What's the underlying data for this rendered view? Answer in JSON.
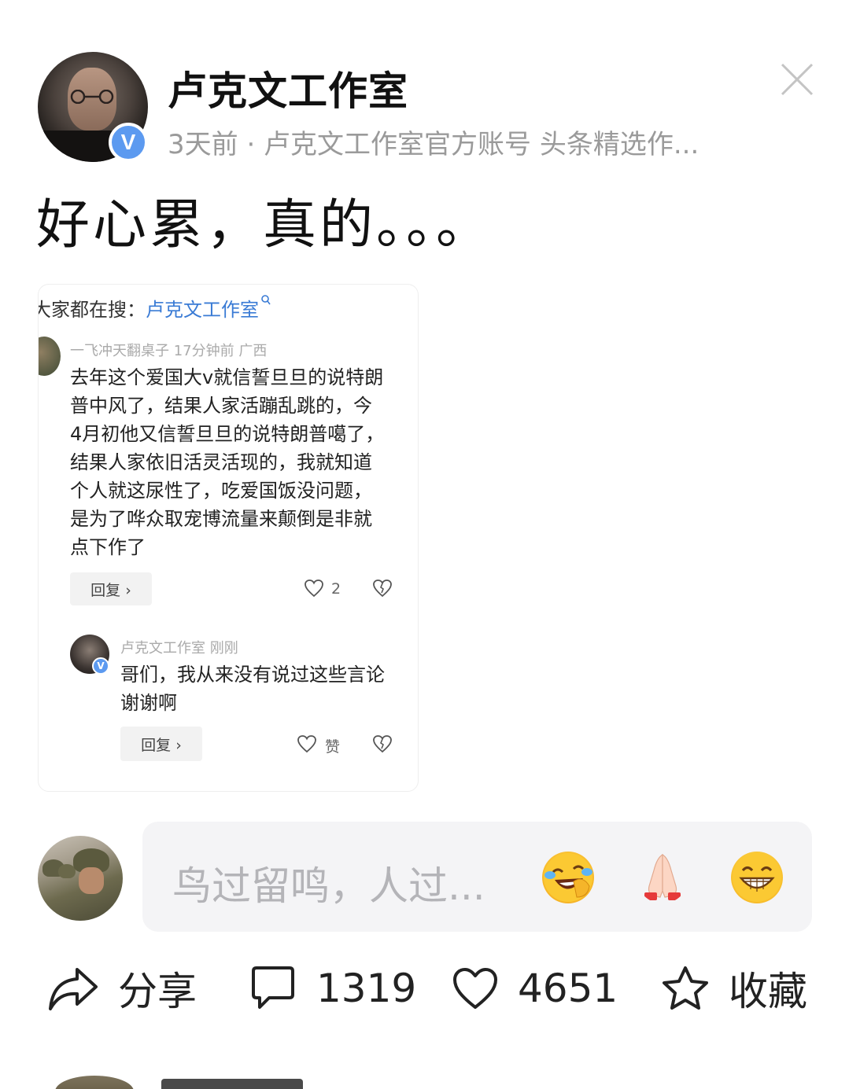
{
  "post": {
    "author": "卢克文工作室",
    "verified_badge": "V",
    "meta": "3天前 · 卢克文工作室官方账号 头条精选作...",
    "title": "好心累，真的。。。"
  },
  "image_comment": {
    "search_prefix": "大家都在搜：",
    "search_keyword": "卢克文工作室",
    "first": {
      "meta": "一飞冲天翻桌子  17分钟前  广西",
      "lines": [
        "去年这个爱国大v就信誓旦旦的说特朗",
        "普中风了，结果人家活蹦乱跳的，今",
        "4月初他又信誓旦旦的说特朗普噶了，",
        "结果人家依旧活灵活现的，我就知道",
        "个人就这尿性了，吃爱国饭没问题，",
        "是为了哗众取宠博流量来颠倒是非就",
        "点下作了"
      ],
      "reply_label": "回复 ›",
      "like_count": "2"
    },
    "second": {
      "meta": "卢克文工作室  刚刚",
      "lines": [
        "哥们，我从来没有说过这些言论",
        "谢谢啊"
      ],
      "reply_label": "回复 ›",
      "like_label": "赞"
    }
  },
  "comment_input": {
    "placeholder": "鸟过留鸣，人过..."
  },
  "emojis": [
    "laughing-crying-emoji",
    "praying-hands-emoji",
    "grinning-emoji"
  ],
  "actions": {
    "share_label": "分享",
    "comment_count": "1319",
    "like_count": "4651",
    "favorite_label": "收藏"
  },
  "colors": {
    "accent_blue": "#5c9af0",
    "keyword_blue": "#3a7bd5",
    "meta_gray": "#9a9a9a",
    "input_bg": "#f4f4f6"
  }
}
